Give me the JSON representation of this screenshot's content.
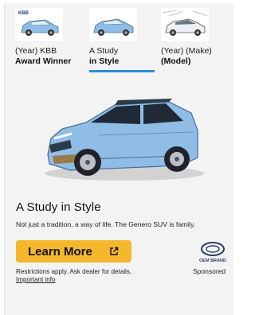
{
  "tabs": [
    {
      "line1": "(Year) KBB",
      "line2": "Award Winner",
      "badge": "KBB"
    },
    {
      "line1": "A Study",
      "line2": "in Style",
      "selected": true
    },
    {
      "line1": "(Year) (Make)",
      "line2": "(Model)"
    }
  ],
  "ad": {
    "headline": "A Study in Style",
    "body": "Not just a tradition, a way of life. The Genero SUV is family.",
    "cta_label": "Learn More",
    "disclaimer": "Restrictions apply. Ask dealer for details.",
    "disclaimer_link": "Important info",
    "oem_brand_label": "OEM BRAND",
    "sponsored_label": "Sponsored"
  },
  "colors": {
    "panel_bg": "#f3f3f3",
    "cta": "#f5b82c",
    "tab_underline": "#2b8fd1",
    "car_body": "#8fbde6"
  }
}
